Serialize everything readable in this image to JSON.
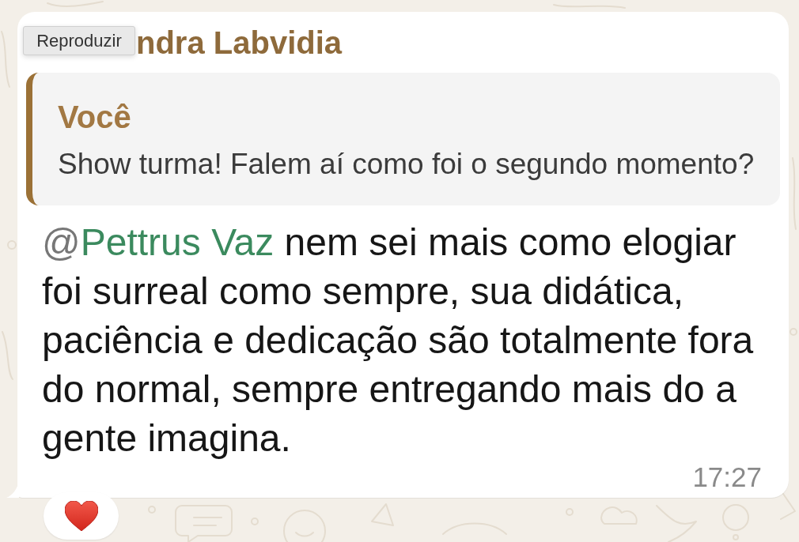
{
  "tooltip": "Reproduzir",
  "message": {
    "sender": "ndra Labvidia",
    "quoted": {
      "author": "Você",
      "text": "Show turma! Falem aí como foi o segundo momento?"
    },
    "mention": {
      "symbol": "@",
      "name": "Pettrus Vaz"
    },
    "text": "nem sei mais como elogiar foi surreal como sempre, sua didática, paciência e dedicação são totalmente fora do normal, sempre entregando mais do a gente imagina.",
    "time": "17:27"
  }
}
